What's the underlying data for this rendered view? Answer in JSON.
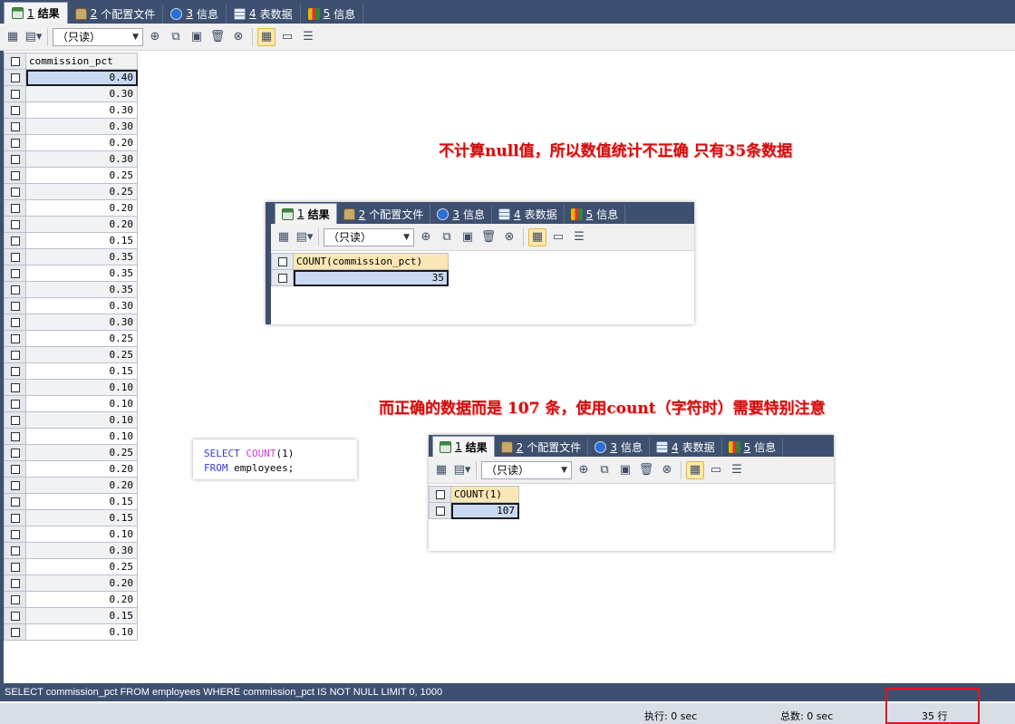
{
  "tabs": [
    {
      "num": "1",
      "label": "结果",
      "icon": "grid-icon"
    },
    {
      "num": "2",
      "label": "个配置文件",
      "icon": "profile-icon"
    },
    {
      "num": "3",
      "label": "信息",
      "icon": "info-icon"
    },
    {
      "num": "4",
      "label": "表数据",
      "icon": "table-icon"
    },
    {
      "num": "5",
      "label": "信息",
      "icon": "chart-icon"
    }
  ],
  "toolbar": {
    "mode_select": "（只读）"
  },
  "main_grid": {
    "column": "commission_pct",
    "rows": [
      "0.40",
      "0.30",
      "0.30",
      "0.30",
      "0.20",
      "0.30",
      "0.25",
      "0.25",
      "0.20",
      "0.20",
      "0.15",
      "0.35",
      "0.35",
      "0.35",
      "0.30",
      "0.30",
      "0.25",
      "0.25",
      "0.15",
      "0.10",
      "0.10",
      "0.10",
      "0.10",
      "0.25",
      "0.20",
      "0.20",
      "0.15",
      "0.15",
      "0.10",
      "0.30",
      "0.25",
      "0.20",
      "0.20",
      "0.15",
      "0.10"
    ]
  },
  "notes": {
    "null_note": "不计算null值，所以数值统计不正确   只有35条数据",
    "correct_note": "而正确的数据而是 107 条，使用count（字符时）需要特别注意"
  },
  "panel_a": {
    "column": "COUNT(commission_pct)",
    "value": "35"
  },
  "panel_b": {
    "column": "COUNT(1)",
    "value": "107"
  },
  "sql_snippet": {
    "line1_kw": "SELECT",
    "line1_fn": "COUNT",
    "line1_rest": "(1)",
    "line2_kw": "FROM",
    "line2_rest": " employees;"
  },
  "query_bar": "SELECT commission_pct FROM employees WHERE commission_pct IS NOT NULL LIMIT 0, 1000",
  "status": {
    "exec": "执行: 0 sec",
    "total": "总数: 0 sec",
    "rows": "35 行"
  },
  "colors": {
    "accent_red": "#d10d0d",
    "tabbar_bg": "#3e5070",
    "selected_cell": "#c9d9f2"
  }
}
